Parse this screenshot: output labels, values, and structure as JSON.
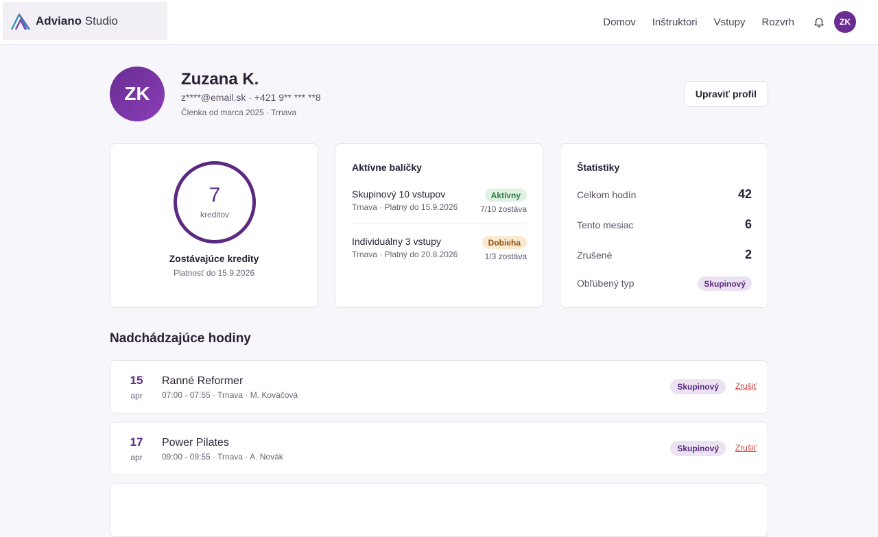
{
  "header": {
    "brand_bold": "Adviano",
    "brand_light": "Studio",
    "nav": [
      "Domov",
      "Inštruktori",
      "Vstupy",
      "Rozvrh"
    ],
    "avatar_initials": "ZK"
  },
  "profile": {
    "initials": "ZK",
    "name": "Zuzana K.",
    "contact": "z****@email.sk · +421 9** *** **8",
    "member": "Členka od marca 2025 · Trnava",
    "edit_label": "Upraviť profil"
  },
  "credits": {
    "value": "7",
    "unit": "kreditov",
    "title": "Zostávajúce kredity",
    "validity": "Platnosť do 15.9.2026"
  },
  "packages": {
    "title": "Aktívne balíčky",
    "items": [
      {
        "name": "Skupinový 10 vstupov",
        "meta": "Trnava · Platný do 15.9.2026",
        "badge": "Aktívny",
        "remaining": "7/10 zostáva"
      },
      {
        "name": "Individuálny 3 vstupy",
        "meta": "Trnava · Platný do 20.8.2026",
        "badge": "Dobieha",
        "remaining": "1/3 zostáva"
      }
    ]
  },
  "stats": {
    "title": "Štatistiky",
    "items": [
      {
        "label": "Celkom hodín",
        "value": "42"
      },
      {
        "label": "Tento mesiac",
        "value": "6"
      },
      {
        "label": "Zrušené",
        "value": "2"
      },
      {
        "label": "Obľúbený typ",
        "value": "Skupinový"
      }
    ]
  },
  "upcoming": {
    "title": "Nadchádzajúce hodiny",
    "lessons": [
      {
        "day": "15",
        "month": "apr",
        "name": "Ranné Reformer",
        "meta": "07:00 - 07:55 · Trnava · M. Kováčová",
        "type": "Skupinový",
        "cancel": "Zrušiť"
      },
      {
        "day": "17",
        "month": "apr",
        "name": "Power Pilates",
        "meta": "09:00 - 09:55 · Trnava · A. Novák",
        "type": "Skupinový",
        "cancel": "Zrušiť"
      }
    ]
  },
  "colors": {
    "accent": "#6a2c91",
    "danger": "#d04545",
    "success_bg": "#dff1e3",
    "warning_bg": "#fde9cf"
  }
}
